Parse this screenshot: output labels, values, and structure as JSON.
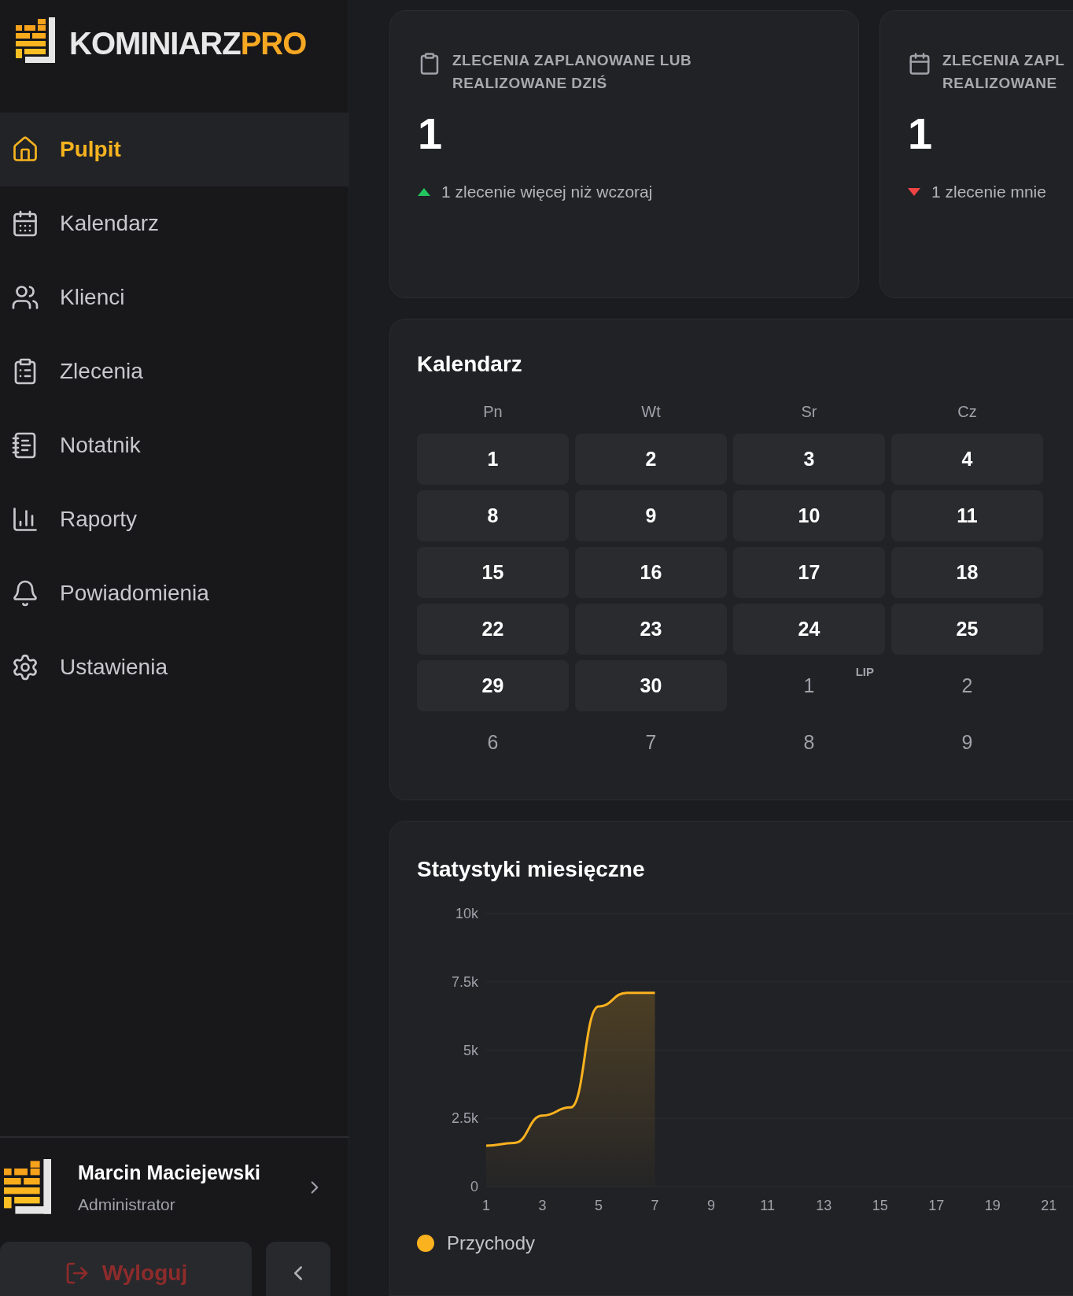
{
  "logo": {
    "text_main": "KOMINIARZ",
    "text_accent": "PRO"
  },
  "sidebar": {
    "items": [
      {
        "label": "Pulpit",
        "selected": true
      },
      {
        "label": "Kalendarz",
        "selected": false
      },
      {
        "label": "Klienci",
        "selected": false
      },
      {
        "label": "Zlecenia",
        "selected": false
      },
      {
        "label": "Notatnik",
        "selected": false
      },
      {
        "label": "Raporty",
        "selected": false
      },
      {
        "label": "Powiadomienia",
        "selected": false
      },
      {
        "label": "Ustawienia",
        "selected": false
      }
    ],
    "user": {
      "name": "Marcin Maciejewski",
      "role": "Administrator"
    },
    "logout_button": "Wyloguj"
  },
  "stat_cards": [
    {
      "title": "ZLECENIA ZAPLANOWANE LUB\nREALIZOWANE DZIŚ",
      "value": "1",
      "trending_up": true,
      "trend_text": "1 zlecenie więcej niż wczoraj"
    },
    {
      "title": "ZLECENIA ZAPL\nREALIZOWANE",
      "value": "1",
      "trending_up": false,
      "trend_text": "1 zlecenie mnie"
    }
  ],
  "calendar": {
    "title": "Kalendarz",
    "weekdays": [
      "Pn",
      "Wt",
      "Sr",
      "Cz"
    ],
    "weeks": [
      [
        {
          "day": "1",
          "in_month": true
        },
        {
          "day": "2",
          "in_month": true
        },
        {
          "day": "3",
          "in_month": true
        },
        {
          "day": "4",
          "in_month": true
        }
      ],
      [
        {
          "day": "8",
          "in_month": true
        },
        {
          "day": "9",
          "in_month": true
        },
        {
          "day": "10",
          "in_month": true
        },
        {
          "day": "11",
          "in_month": true
        }
      ],
      [
        {
          "day": "15",
          "in_month": true
        },
        {
          "day": "16",
          "in_month": true
        },
        {
          "day": "17",
          "in_month": true
        },
        {
          "day": "18",
          "in_month": true
        }
      ],
      [
        {
          "day": "22",
          "in_month": true
        },
        {
          "day": "23",
          "in_month": true
        },
        {
          "day": "24",
          "in_month": true
        },
        {
          "day": "25",
          "in_month": true
        }
      ],
      [
        {
          "day": "29",
          "in_month": true
        },
        {
          "day": "30",
          "in_month": true
        },
        {
          "day": "1",
          "in_month": false,
          "month_label": "LIP"
        },
        {
          "day": "2",
          "in_month": false
        }
      ],
      [
        {
          "day": "6",
          "in_month": false
        },
        {
          "day": "7",
          "in_month": false
        },
        {
          "day": "8",
          "in_month": false
        },
        {
          "day": "9",
          "in_month": false
        }
      ]
    ]
  },
  "monthly_stats": {
    "title": "Statystyki miesięczne",
    "chart_data": {
      "type": "area",
      "grid": true,
      "x": [
        1,
        2,
        3,
        4,
        5,
        6,
        7
      ],
      "xlim": [
        1,
        22
      ],
      "ylim": [
        0,
        10000
      ],
      "xticks": [
        1,
        3,
        5,
        7,
        9,
        11,
        13,
        15,
        17,
        19,
        21
      ],
      "yticks": [
        {
          "value": 0,
          "label": "0"
        },
        {
          "value": 2500,
          "label": "2.5k"
        },
        {
          "value": 5000,
          "label": "5k"
        },
        {
          "value": 7500,
          "label": "7.5k"
        },
        {
          "value": 10000,
          "label": "10k"
        }
      ],
      "series": [
        {
          "name": "Przychody",
          "color": "#fbb21f",
          "values": [
            1500,
            1600,
            2600,
            2900,
            6600,
            7100,
            7100
          ]
        }
      ]
    }
  }
}
